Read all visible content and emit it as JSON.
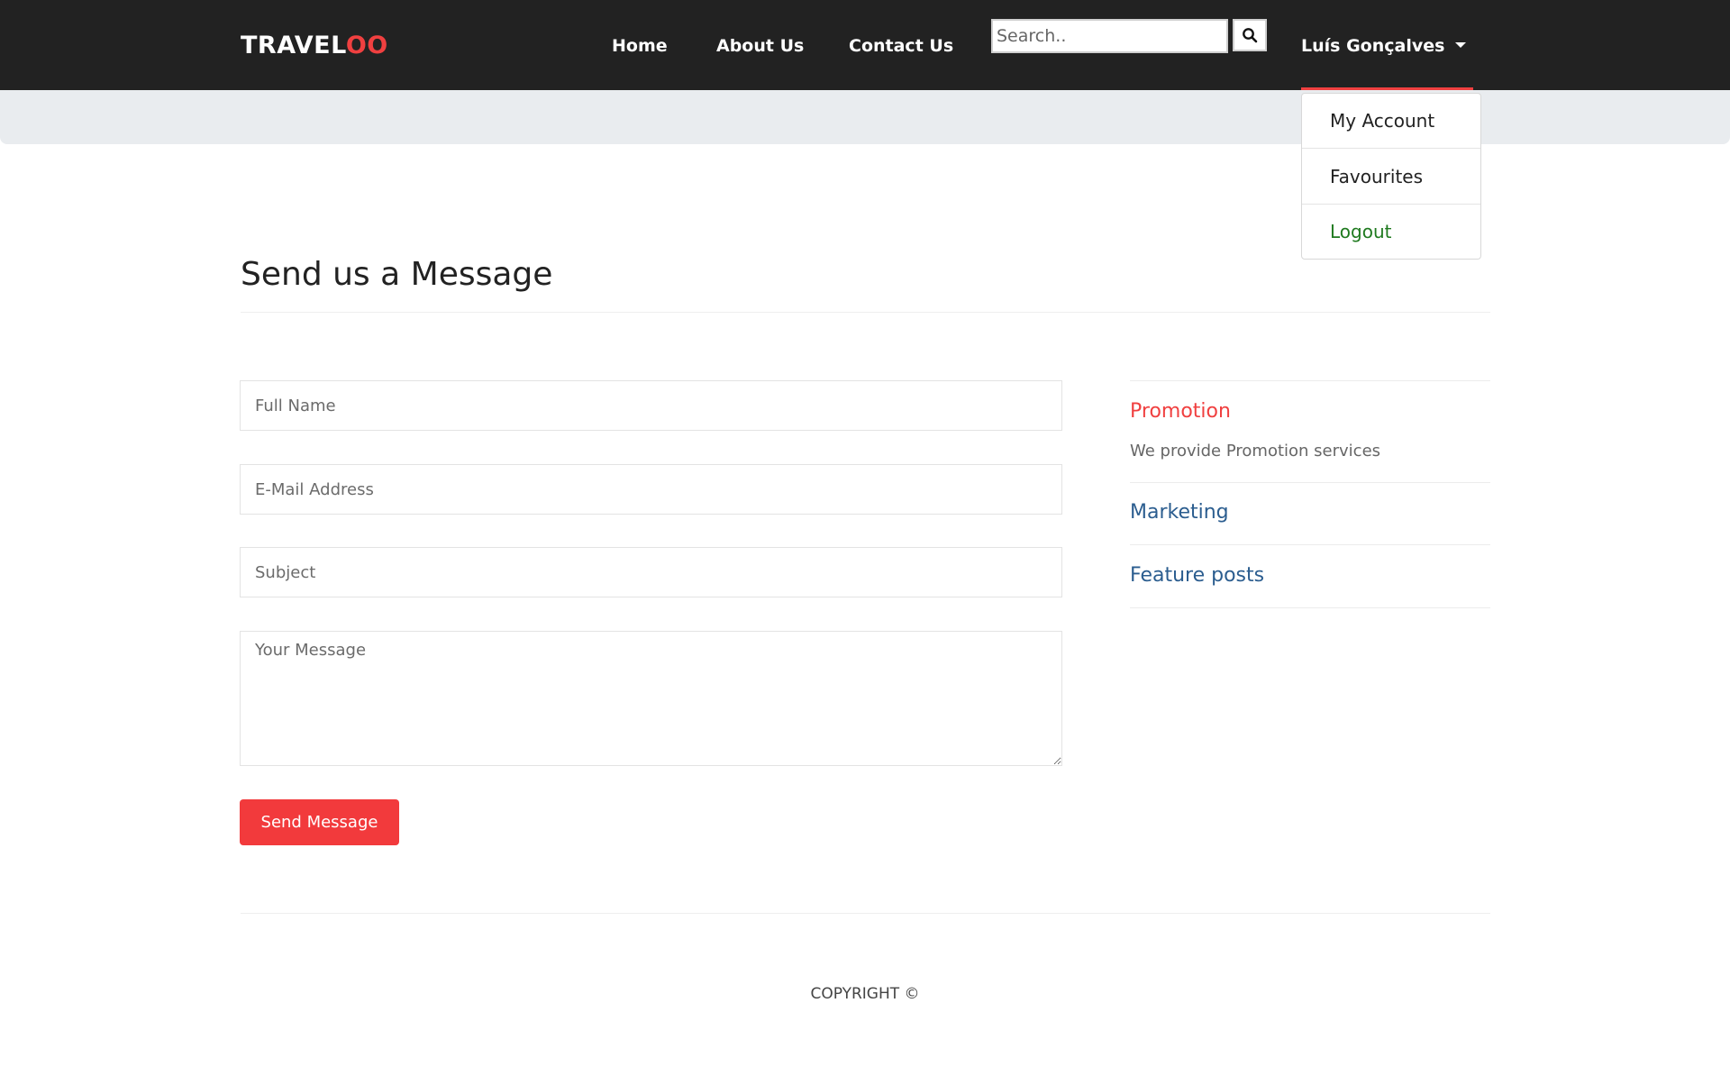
{
  "brand": {
    "part1": "TRAVEL",
    "part2": "OO"
  },
  "nav": {
    "home": "Home",
    "about": "About Us",
    "contact": "Contact Us",
    "search_placeholder": "Search..",
    "search_icon": "search-icon",
    "user_name": "Luís Gonçalves",
    "accent_color": "#f04040"
  },
  "user_menu": {
    "items": [
      "My Account",
      "Favourites",
      "Logout"
    ],
    "logout_color": "#1f7a1f"
  },
  "page": {
    "title": "Send us a Message"
  },
  "form": {
    "full_name_placeholder": "Full Name",
    "email_placeholder": "E-Mail Address",
    "subject_placeholder": "Subject",
    "message_placeholder": "Your Message",
    "submit_label": "Send Message",
    "submit_color": "#f23a3c"
  },
  "sidebar": {
    "promotion_title": "Promotion",
    "promotion_desc": "We provide Promotion services",
    "marketing_title": "Marketing",
    "feature_title": "Feature posts"
  },
  "footer": {
    "copyright": "COPYRIGHT ©"
  }
}
